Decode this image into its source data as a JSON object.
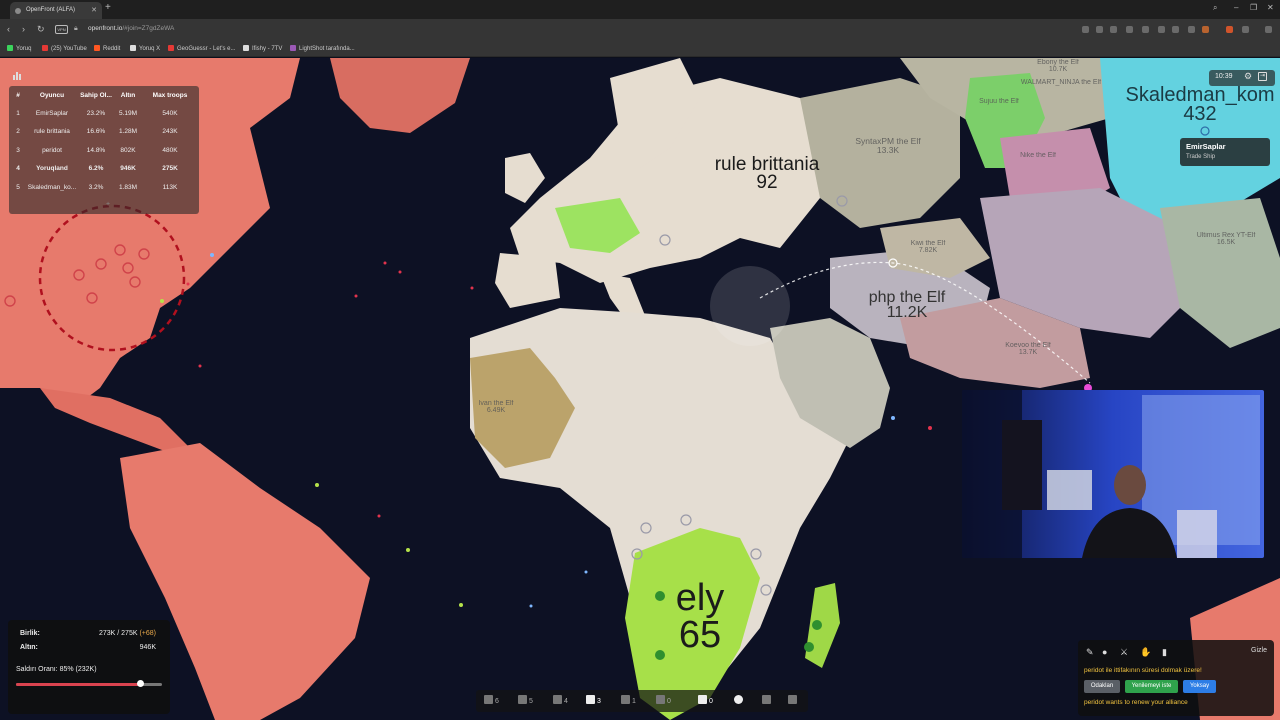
{
  "browser": {
    "tab_title": "OpenFront (ALFA)",
    "url_host": "openfront.io",
    "url_path": "/#join=Z7gdZeWA",
    "vpn_label": "VPN",
    "bookmarks": [
      {
        "label": "Yoruq",
        "color": "#3bd45c"
      },
      {
        "label": "(25) YouTube",
        "color": "#e53935"
      },
      {
        "label": "Reddit",
        "color": "#ff5722"
      },
      {
        "label": "Yoruq X",
        "color": "#dddddd"
      },
      {
        "label": "GeoGuessr - Let's e...",
        "color": "#e53935"
      },
      {
        "label": "Ifishy - 7TV",
        "color": "#dddddd"
      },
      {
        "label": "LightShot tarafında...",
        "color": "#9b59b6"
      }
    ]
  },
  "leaderboard": {
    "headers": [
      "#",
      "Oyuncu",
      "Sahip Ol...",
      "Altın",
      "Max troops"
    ],
    "rows": [
      {
        "rank": "1",
        "name": "EmirSaplar",
        "owned": "23.2%",
        "gold": "5.19M",
        "troops": "540K"
      },
      {
        "rank": "2",
        "name": "rule brittania",
        "owned": "16.6%",
        "gold": "1.28M",
        "troops": "243K"
      },
      {
        "rank": "3",
        "name": "peridot",
        "owned": "14.8%",
        "gold": "802K",
        "troops": "480K"
      },
      {
        "rank": "4",
        "name": "Yoruqland",
        "owned": "6.2%",
        "gold": "946K",
        "troops": "275K"
      },
      {
        "rank": "5",
        "name": "Skaledman_ko...",
        "owned": "3.2%",
        "gold": "1.83M",
        "troops": "113K"
      }
    ],
    "expand_glyph": "+"
  },
  "timer": "10:39",
  "tooltip": {
    "player": "EmirSaplar",
    "unit": "Trade Ship"
  },
  "map_labels": {
    "big": [
      {
        "name": "rule brittania",
        "value": "92"
      },
      {
        "name": "php the Elf",
        "value": "11.2K"
      },
      {
        "name": "ely",
        "value": "65"
      },
      {
        "name": "Skaledman_kom",
        "value": "432"
      }
    ],
    "small": [
      {
        "name": "SyntaxPM the Elf",
        "value": "13.3K"
      },
      {
        "name": "Ivan the Elf",
        "value": "6.49K"
      },
      {
        "name": "Koevoo the Elf",
        "value": "13.7K"
      },
      {
        "name": "Ebony the Elf",
        "value": "10.7K"
      },
      {
        "name": "WALMART_NINJA the Elf",
        "value": ""
      },
      {
        "name": "Ultimus Rex YT-Elf",
        "value": "16.5K"
      },
      {
        "name": "Kiwi the Elf",
        "value": "7.82K"
      },
      {
        "name": "Nike the Elf",
        "value": ""
      },
      {
        "name": "Sujuu the Elf",
        "value": ""
      }
    ]
  },
  "stats": {
    "troops_label": "Birlik:",
    "troops_value": "273K / 275K",
    "troops_delta": "(+68)",
    "gold_label": "Altın:",
    "gold_value": "946K",
    "attack_label": "Saldırı Oranı: 85% (232K)",
    "attack_ratio": 0.85
  },
  "buildbar": [
    {
      "count": "6",
      "icon": "city-icon"
    },
    {
      "count": "5",
      "icon": "factory-icon"
    },
    {
      "count": "4",
      "icon": "port-icon"
    },
    {
      "count": "3",
      "icon": "defense-icon"
    },
    {
      "count": "1",
      "icon": "missile-icon"
    },
    {
      "count": "0",
      "icon": "silo-icon"
    },
    {
      "count": "0",
      "icon": "warship-icon"
    }
  ],
  "alliance": {
    "hide_label": "Gizle",
    "message": "peridot ile ittifakının süresi dolmak üzere!",
    "btn_focus": "Odaklan",
    "btn_renew": "Yenilemeyi iste",
    "btn_ignore": "Yoksay",
    "message2": "peridot wants to renew your alliance"
  },
  "colors": {
    "ocean": "#0d1124",
    "self_territory": "#e77a6c",
    "rule_brittania": "#e6ddd0",
    "ely": "#a7e049",
    "skaledman": "#63d2e0"
  }
}
